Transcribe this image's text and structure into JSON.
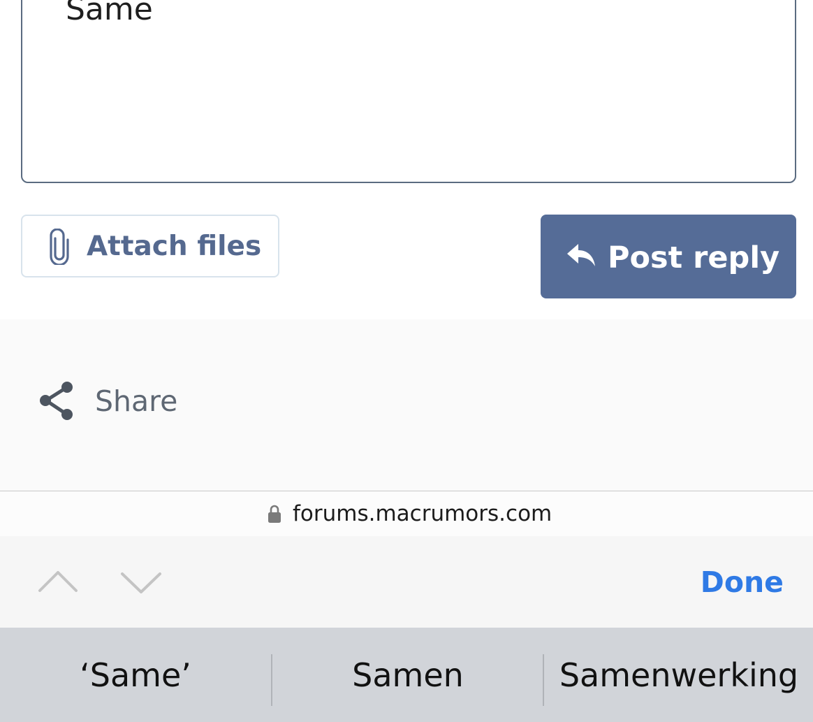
{
  "editor": {
    "value": "Same"
  },
  "actions": {
    "attach_label": "Attach files",
    "post_label": "Post reply"
  },
  "footer": {
    "share_label": "Share"
  },
  "urlbar": {
    "url": "forums.macrumors.com"
  },
  "accessory": {
    "done_label": "Done"
  },
  "suggestions": [
    {
      "label": "‘Same’"
    },
    {
      "label": "Samen"
    },
    {
      "label": "Samenwerking"
    }
  ],
  "colors": {
    "accent": "#556c97",
    "attach_text": "#55698f",
    "done": "#2f7ae5",
    "keyboard_bg": "#d1d4d9"
  },
  "icons": {
    "attach": "paperclip-icon",
    "post": "reply-arrow-icon",
    "share": "share-icon",
    "lock": "lock-icon",
    "prev": "chevron-up-icon",
    "next": "chevron-down-icon"
  }
}
